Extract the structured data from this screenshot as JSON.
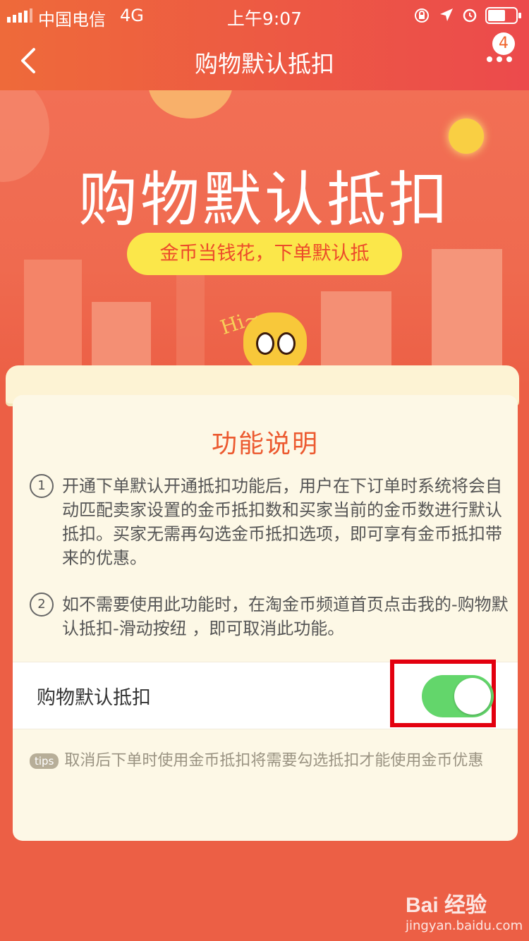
{
  "status_bar": {
    "carrier": "中国电信",
    "network": "4G",
    "time": "上午9:07"
  },
  "nav": {
    "title": "购物默认抵扣",
    "badge": "4"
  },
  "hero": {
    "title": "购物默认抵扣",
    "slogan": "金币当钱花，下单默认抵",
    "mascot_text": "Hi~"
  },
  "card": {
    "section_title": "功能说明",
    "items": [
      {
        "num": "1",
        "text": "开通下单默认开通抵扣功能后，用户在下订单时系统将会自动匹配卖家设置的金币抵扣数和买家当前的金币数进行默认抵扣。买家无需再勾选金币抵扣选项，即可享有金币抵扣带来的优惠。"
      },
      {
        "num": "2",
        "text": "如不需要使用此功能时，在淘金币频道首页点击我的-购物默认抵扣-滑动按纽 ，即可取消此功能。"
      }
    ],
    "toggle_row": {
      "label": "购物默认抵扣",
      "state": "on"
    },
    "tips": {
      "badge": "tips",
      "text": "取消后下单时使用金币抵扣将需要勾选抵扣才能使用金币优惠"
    }
  },
  "watermark": {
    "brand": "Bai 经验",
    "url": "jingyan.baidu.com"
  },
  "colors": {
    "accent": "#ec5a30",
    "toggle_on": "#63d66b",
    "highlight": "#e3000f"
  }
}
